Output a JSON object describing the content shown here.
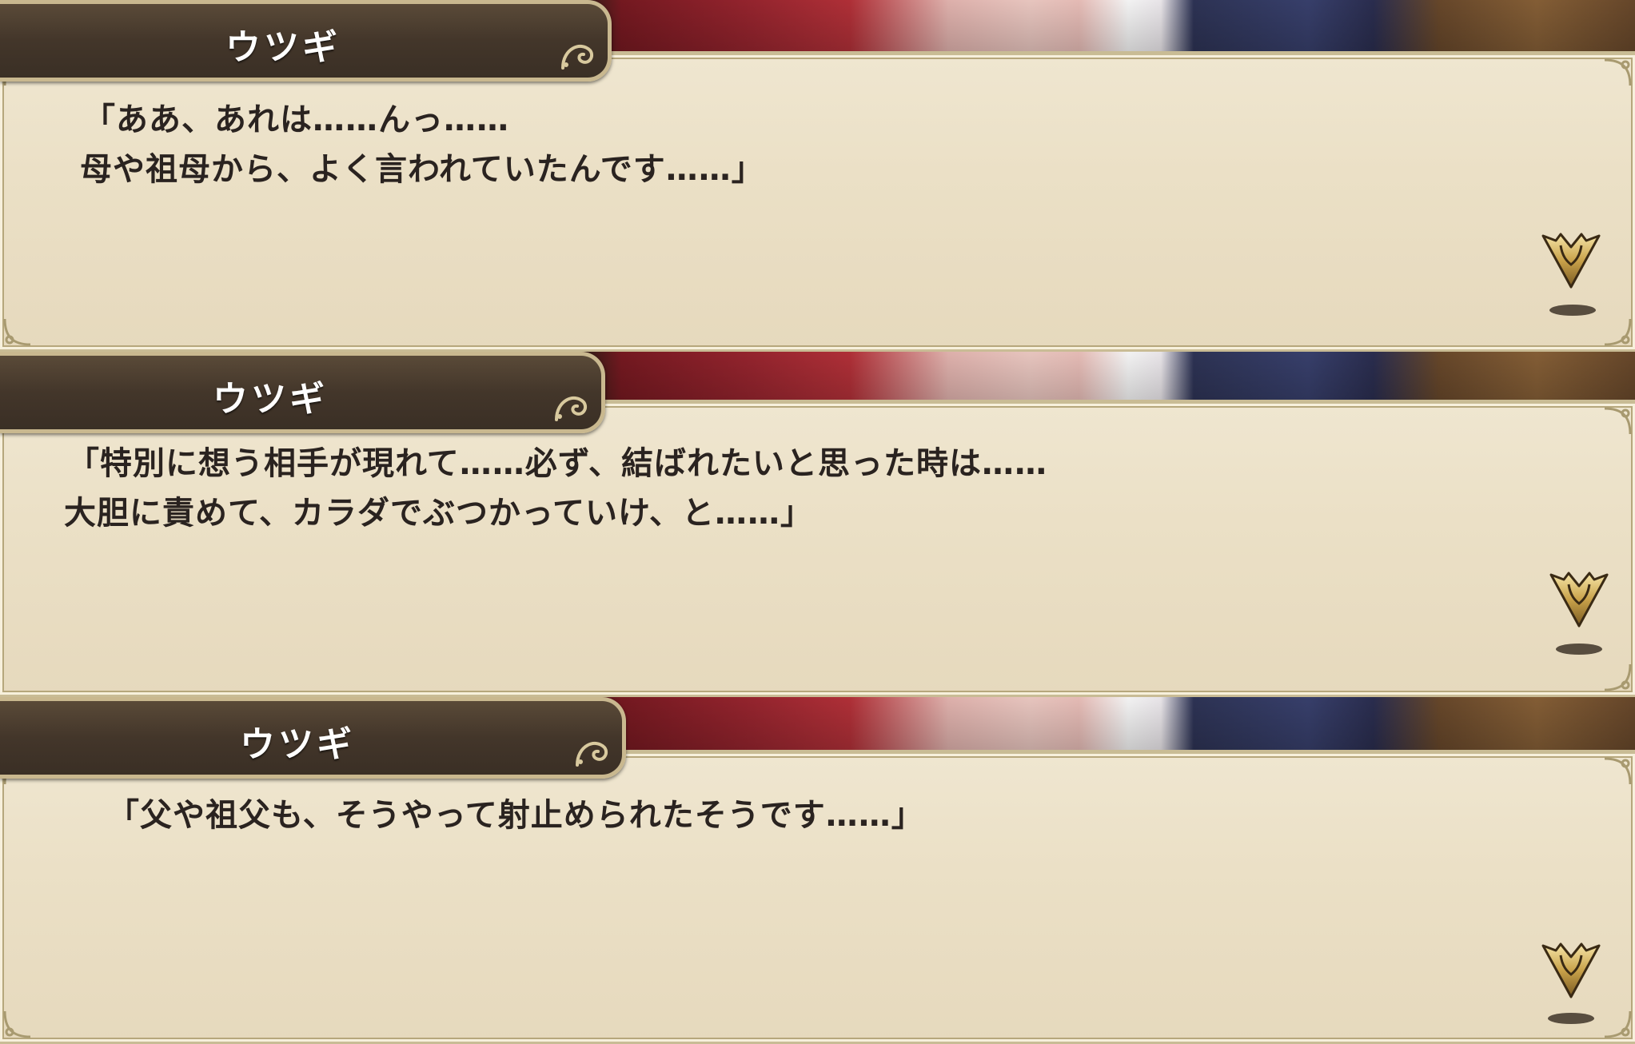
{
  "dialogues": [
    {
      "speaker": "ウツギ",
      "line1": "「ああ、あれは……んっ……",
      "line2": "母や祖母から、よく言われていたんです……」"
    },
    {
      "speaker": "ウツギ",
      "line1": "「特別に想う相手が現れて……必ず、結ばれたいと思った時は……",
      "line2": "大胆に責めて、カラダでぶつかっていけ、と……」"
    },
    {
      "speaker": "ウツギ",
      "line1": "「父や祖父も、そうやって射止められたそうです……」",
      "line2": ""
    }
  ],
  "icons": {
    "advance": "advance-chevron-icon",
    "corner": "ornament-corner-icon",
    "nameplate_swirl": "swirl-ornament-icon"
  },
  "colors": {
    "textbox_bg": "#ece2c8",
    "nameplate_bg": "#43362a",
    "gold": "#c9a24a",
    "text": "#2a2320"
  }
}
